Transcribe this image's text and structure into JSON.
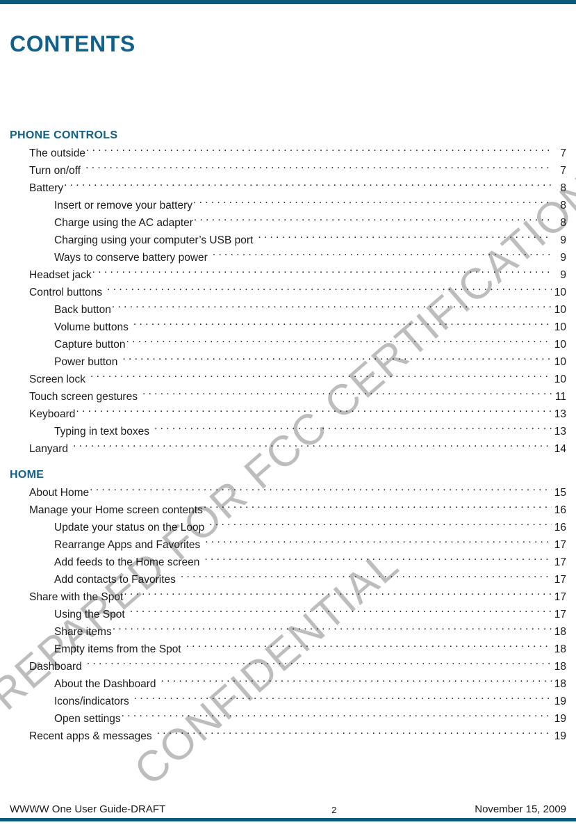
{
  "document": {
    "title": "CONTENTS",
    "accent_color": "#0a5b7c",
    "heading_color": "#10608a"
  },
  "watermark": {
    "line1": "PREPARED FOR FCC CERTIFICATION",
    "line2": "CONFIDENTIAL",
    "color": "#bdbdbd"
  },
  "toc": {
    "sections": [
      {
        "heading": "PHONE CONTROLS",
        "entries": [
          {
            "title": "The outside",
            "page": "7",
            "level": 1
          },
          {
            "title": "Turn on/off",
            "page": "7",
            "level": 1,
            "gap": true
          },
          {
            "title": "Battery",
            "page": "8",
            "level": 1
          },
          {
            "title": "Insert or remove your battery",
            "page": "8",
            "level": 2
          },
          {
            "title": "Charge using the AC adapter",
            "page": "8",
            "level": 2
          },
          {
            "title": "Charging using your computer’s USB port",
            "page": "9",
            "level": 2,
            "gap": true
          },
          {
            "title": "Ways to conserve battery power",
            "page": "9",
            "level": 2,
            "gap": true
          },
          {
            "title": "Headset jack",
            "page": "9",
            "level": 1
          },
          {
            "title": "Control buttons",
            "page": "10",
            "level": 1,
            "gap": true
          },
          {
            "title": "Back button",
            "page": "10",
            "level": 2
          },
          {
            "title": "Volume buttons",
            "page": "10",
            "level": 2,
            "gap": true
          },
          {
            "title": "Capture button",
            "page": "10",
            "level": 2
          },
          {
            "title": "Power button",
            "page": "10",
            "level": 2,
            "gap": true
          },
          {
            "title": "Screen lock",
            "page": "10",
            "level": 1,
            "gap": true
          },
          {
            "title": "Touch screen gestures",
            "page": "11",
            "level": 1,
            "gap": true
          },
          {
            "title": "Keyboard",
            "page": "13",
            "level": 1
          },
          {
            "title": "Typing in text boxes",
            "page": "13",
            "level": 2,
            "gap": true
          },
          {
            "title": "Lanyard",
            "page": "14",
            "level": 1,
            "gap": true
          }
        ]
      },
      {
        "heading": "HOME",
        "entries": [
          {
            "title": "About Home",
            "page": "15",
            "level": 1
          },
          {
            "title": "Manage your Home screen contents",
            "page": "16",
            "level": 1
          },
          {
            "title": "Update your status on the Loop",
            "page": "16",
            "level": 2,
            "gap": true
          },
          {
            "title": "Rearrange Apps and Favorites",
            "page": "17",
            "level": 2,
            "gap": true
          },
          {
            "title": "Add feeds to the Home screen",
            "page": "17",
            "level": 2,
            "gap": true
          },
          {
            "title": "Add contacts to Favorites",
            "page": "17",
            "level": 2,
            "gap": true
          },
          {
            "title": "Share with the Spot",
            "page": "17",
            "level": 1
          },
          {
            "title": "Using the Spot",
            "page": "17",
            "level": 2,
            "gap": true
          },
          {
            "title": "Share items",
            "page": "18",
            "level": 2
          },
          {
            "title": "Empty items from the Spot",
            "page": "18",
            "level": 2,
            "gap": true
          },
          {
            "title": "Dashboard",
            "page": "18",
            "level": 1,
            "gap": true
          },
          {
            "title": "About the Dashboard",
            "page": "18",
            "level": 2,
            "gap": true
          },
          {
            "title": "Icons/indicators",
            "page": "19",
            "level": 2,
            "gap": true
          },
          {
            "title": "Open settings",
            "page": "19",
            "level": 2
          },
          {
            "title": "Recent apps & messages",
            "page": "19",
            "level": 1,
            "gap": true
          }
        ]
      }
    ]
  },
  "footer": {
    "left": "WWWW One User Guide-DRAFT",
    "page_number": "2",
    "right": "November 15, 2009"
  }
}
